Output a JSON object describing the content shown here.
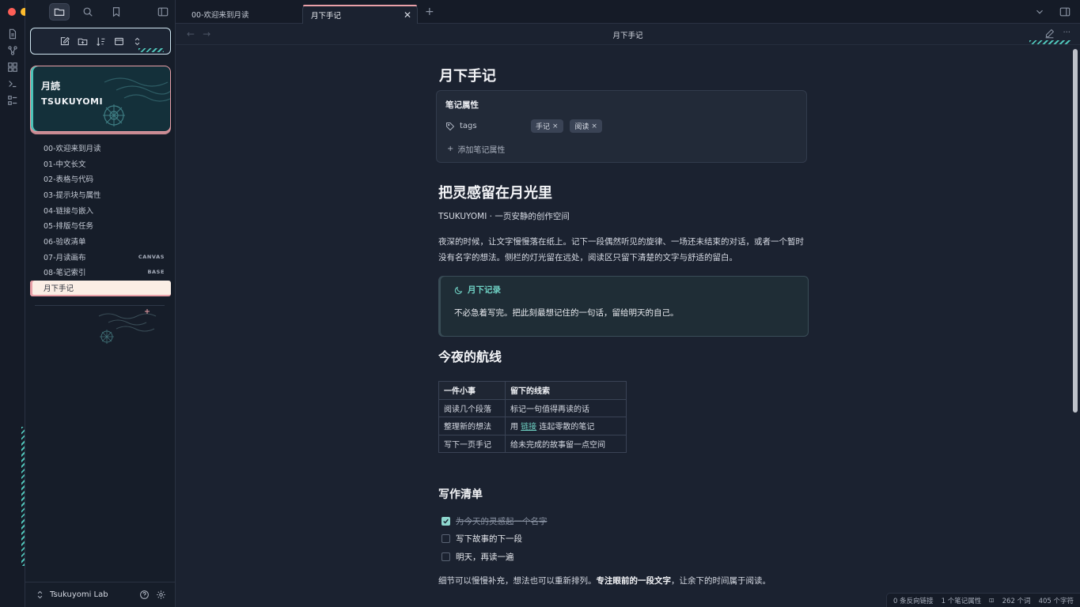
{
  "tabs": {
    "tab1": "00-欢迎来到月读",
    "tab2": "月下手记",
    "close": "✕",
    "plus": "+"
  },
  "view": {
    "title": "月下手记",
    "back": "←",
    "forward": "→",
    "more": "···"
  },
  "sidebar": {
    "banner_line1": "月読",
    "banner_line2": "TSUKUYOMI",
    "files": [
      {
        "name": "00-欢迎来到月读",
        "badge": ""
      },
      {
        "name": "01-中文长文",
        "badge": ""
      },
      {
        "name": "02-表格与代码",
        "badge": ""
      },
      {
        "name": "03-提示块与属性",
        "badge": ""
      },
      {
        "name": "04-链接与嵌入",
        "badge": ""
      },
      {
        "name": "05-排版与任务",
        "badge": ""
      },
      {
        "name": "06-验收清单",
        "badge": ""
      },
      {
        "name": "07-月读画布",
        "badge": "CANVAS"
      },
      {
        "name": "08-笔记索引",
        "badge": "BASE"
      },
      {
        "name": "月下手记",
        "badge": ""
      }
    ],
    "vault_name": "Tsukuyomi Lab",
    "vault_switch": "⌃⌄"
  },
  "note": {
    "title": "月下手记",
    "properties_heading": "笔记属性",
    "property_key": "tags",
    "tags": [
      "手记",
      "阅读"
    ],
    "tag_remove": "×",
    "add_property": "添加笔记属性",
    "add_glyph": "+",
    "h1": "把灵感留在月光里",
    "subtitle": "TSUKUYOMI · 一页安静的创作空间",
    "paragraph": "夜深的时候，让文字慢慢落在纸上。记下一段偶然听见的旋律、一场还未结束的对话，或者一个暂时没有名字的想法。侧栏的灯光留在远处，阅读区只留下清楚的文字与舒适的留白。",
    "callout_title": "月下记录",
    "callout_body": "不必急着写完。把此刻最想记住的一句话，留给明天的自己。",
    "h2": "今夜的航线",
    "table": {
      "headers": [
        "一件小事",
        "留下的线索"
      ],
      "rows": [
        [
          "阅读几个段落",
          "标记一句值得再读的话"
        ],
        [
          "整理新的想法",
          "用 链接 连起零散的笔记"
        ],
        [
          "写下一页手记",
          "给未完成的故事留一点空间"
        ]
      ],
      "row2_prefix": "用 ",
      "row2_link": "链接",
      "row2_suffix": " 连起零散的笔记"
    },
    "h3": "写作清单",
    "tasks": [
      {
        "text": "为今天的灵感起一个名字",
        "done": true
      },
      {
        "text": "写下故事的下一段",
        "done": false
      },
      {
        "text": "明天，再读一遍",
        "done": false
      }
    ],
    "closing_pre": "细节可以慢慢补充，想法也可以重新排列。",
    "closing_bold": "专注眼前的一段文字",
    "closing_post": "，让余下的时间属于阅读。"
  },
  "status": {
    "backlinks": "0 条反向链接",
    "properties": "1 个笔记属性",
    "words": "262 个词",
    "chars": "405 个字符"
  },
  "colors": {
    "accent_teal": "#4fc3b8",
    "accent_pink": "#e9a0a8",
    "background": "#1b2230"
  },
  "icons": [
    "files-icon",
    "search-icon",
    "bookmark-icon",
    "sidebar-toggle-icon",
    "new-note-icon",
    "new-folder-icon",
    "sort-icon",
    "collapse-icon",
    "tag-icon",
    "moon-icon",
    "help-icon",
    "settings-icon",
    "edit-icon",
    "reading-icon"
  ]
}
